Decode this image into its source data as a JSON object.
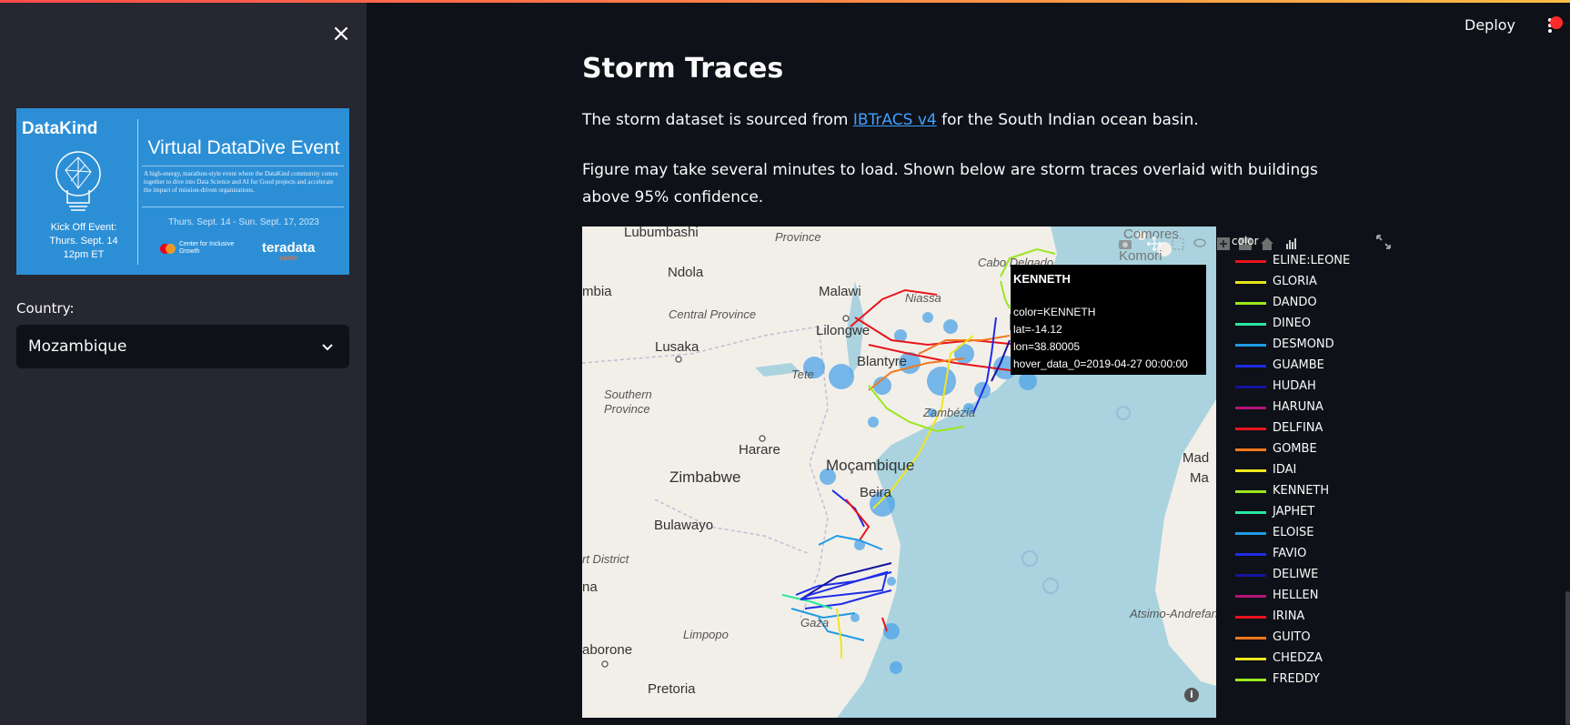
{
  "header": {
    "deploy_label": "Deploy"
  },
  "sidebar": {
    "close_label": "×",
    "banner": {
      "logo": "DataKind",
      "title": "Virtual DataDive Event",
      "description": "A high-energy, marathon-style event where the DataKind community comes together to dive into Data Science and AI for Good projects and accelerate the impact of mission-driven organizations.",
      "kickoff_line1": "Kick Off Event:",
      "kickoff_line2": "Thurs. Sept. 14",
      "kickoff_line3": "12pm ET",
      "dates": "Thurs. Sept. 14 - Sun. Sept. 17, 2023",
      "sponsor1": "Center for Inclusive Growth",
      "sponsor2": "teradata",
      "sponsor2_sub": "cares"
    },
    "country_label": "Country:",
    "country_value": "Mozambique"
  },
  "main": {
    "title": "Storm Traces",
    "para1_before": "The storm dataset is sourced from ",
    "para1_link": "IBTrACS v4",
    "para1_after": " for the South Indian ocean basin.",
    "para2": "Figure may take several minutes to load. Shown below are storm traces overlaid with buildings above 95% confidence."
  },
  "map": {
    "places": {
      "lubumbashi": "Lubumbashi",
      "province1": "Province",
      "ndola": "Ndola",
      "malawi": "Malawi",
      "niassa": "Niassa",
      "mbia": "mbia",
      "central_province": "Central Province",
      "lilongwe": "Lilongwe",
      "lusaka": "Lusaka",
      "blantyre": "Blantyre",
      "tete": "Tete",
      "southern_province": "Southern",
      "southern_province2": "Province",
      "zambezia": "Zambézia",
      "harare": "Harare",
      "zimbabwe": "Zimbabwe",
      "mocambique": "Moçambique",
      "beira": "Beira",
      "bulawayo": "Bulawayo",
      "rt_district": "rt District",
      "na": "na",
      "limpopo": "Limpopo",
      "gaza": "Gaza",
      "aborone": "aborone",
      "pretoria": "Pretoria",
      "comores": "Comores",
      "komori": "Komori",
      "cabo_delgado": "Cabo Delgado",
      "mad": "Mad",
      "ma": "Ma",
      "atsimo": "Atsimo-Andrefan"
    }
  },
  "legend": {
    "title": "color",
    "items": [
      {
        "label": "ELINE:LEONE",
        "color": "#e8141c"
      },
      {
        "label": "GLORIA",
        "color": "#e6e619"
      },
      {
        "label": "DANDO",
        "color": "#9be61e"
      },
      {
        "label": "DINEO",
        "color": "#2ae6a0"
      },
      {
        "label": "DESMOND",
        "color": "#1e9be6"
      },
      {
        "label": "GUAMBE",
        "color": "#1e2ce6"
      },
      {
        "label": "HUDAH",
        "color": "#1414a0"
      },
      {
        "label": "HARUNA",
        "color": "#b41478"
      },
      {
        "label": "DELFINA",
        "color": "#e8141c"
      },
      {
        "label": "GOMBE",
        "color": "#f0781e"
      },
      {
        "label": "IDAI",
        "color": "#f0e61e"
      },
      {
        "label": "KENNETH",
        "color": "#9be61e"
      },
      {
        "label": "JAPHET",
        "color": "#2ae6a0"
      },
      {
        "label": "ELOISE",
        "color": "#1e9be6"
      },
      {
        "label": "FAVIO",
        "color": "#1e2ce6"
      },
      {
        "label": "DELIWE",
        "color": "#1414a0"
      },
      {
        "label": "HELLEN",
        "color": "#b41478"
      },
      {
        "label": "IRINA",
        "color": "#e8141c"
      },
      {
        "label": "GUITO",
        "color": "#f0781e"
      },
      {
        "label": "CHEDZA",
        "color": "#f0e61e"
      },
      {
        "label": "FREDDY",
        "color": "#9be61e"
      }
    ]
  },
  "tooltip": {
    "title": "KENNETH",
    "line1": "color=KENNETH",
    "line2": "lat=-14.12",
    "line3": "lon=38.80005",
    "line4": "hover_data_0=2019-04-27 00:00:00"
  },
  "info_label": "i"
}
